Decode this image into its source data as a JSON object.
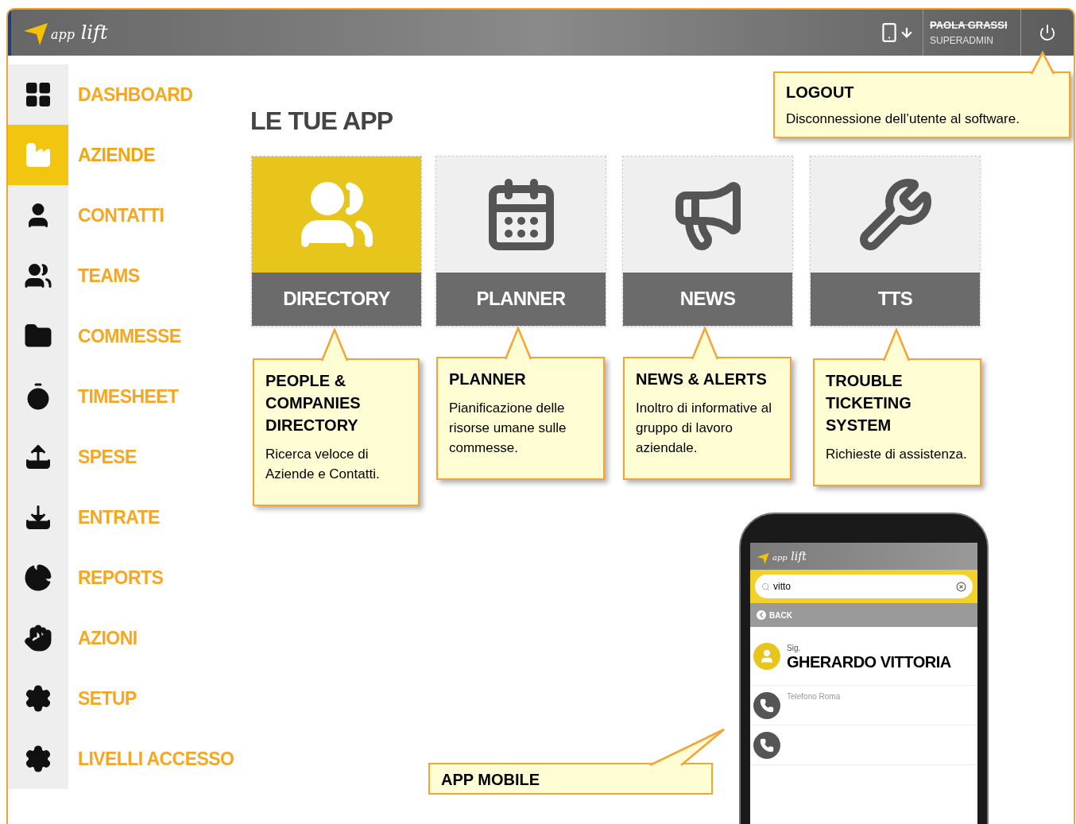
{
  "header": {
    "logo": {
      "prefix": "app",
      "name": "lift"
    },
    "user": {
      "name": "PAOLA GRASSI",
      "role": "SUPERADMIN"
    }
  },
  "sidebar": {
    "items": [
      {
        "label": "DASHBOARD",
        "selected": false
      },
      {
        "label": "AZIENDE",
        "selected": true
      },
      {
        "label": "CONTATTI",
        "selected": false
      },
      {
        "label": "TEAMS",
        "selected": false
      },
      {
        "label": "COMMESSE",
        "selected": false
      },
      {
        "label": "TIMESHEET",
        "selected": false
      },
      {
        "label": "SPESE",
        "selected": false
      },
      {
        "label": "ENTRATE",
        "selected": false
      },
      {
        "label": "REPORTS",
        "selected": false
      },
      {
        "label": "AZIONI",
        "selected": false
      },
      {
        "label": "SETUP",
        "selected": false
      },
      {
        "label": "LIVELLI ACCESSO",
        "selected": false
      }
    ]
  },
  "heading": "LE TUE APP",
  "apps": [
    {
      "label": "DIRECTORY",
      "selected": true
    },
    {
      "label": "PLANNER",
      "selected": false
    },
    {
      "label": "NEWS",
      "selected": false
    },
    {
      "label": "TTS",
      "selected": false
    }
  ],
  "callouts": [
    {
      "title": "PEOPLE & COMPANIES DIRECTORY",
      "text": "Ricerca veloce di Aziende e Contatti."
    },
    {
      "title": "PLANNER",
      "text": "Pianificazione delle risorse umane sulle commesse."
    },
    {
      "title": "NEWS & ALERTS",
      "text": "Inoltro di informative al gruppo di lavoro aziendale."
    },
    {
      "title": "TROUBLE TICKETING SYSTEM",
      "text": "Richieste di assistenza."
    }
  ],
  "logout_callout": {
    "title": "LOGOUT",
    "text": "Disconnessione dell’utente al software."
  },
  "mobile_callout": {
    "title": "APP MOBILE"
  },
  "phone": {
    "logo": {
      "prefix": "app",
      "name": "lift"
    },
    "search_value": "vitto",
    "back": "BACK",
    "contact": {
      "title": "Sig.",
      "name": "GHERARDO VITTORIA"
    },
    "phone_label": "Telefono Roma"
  }
}
